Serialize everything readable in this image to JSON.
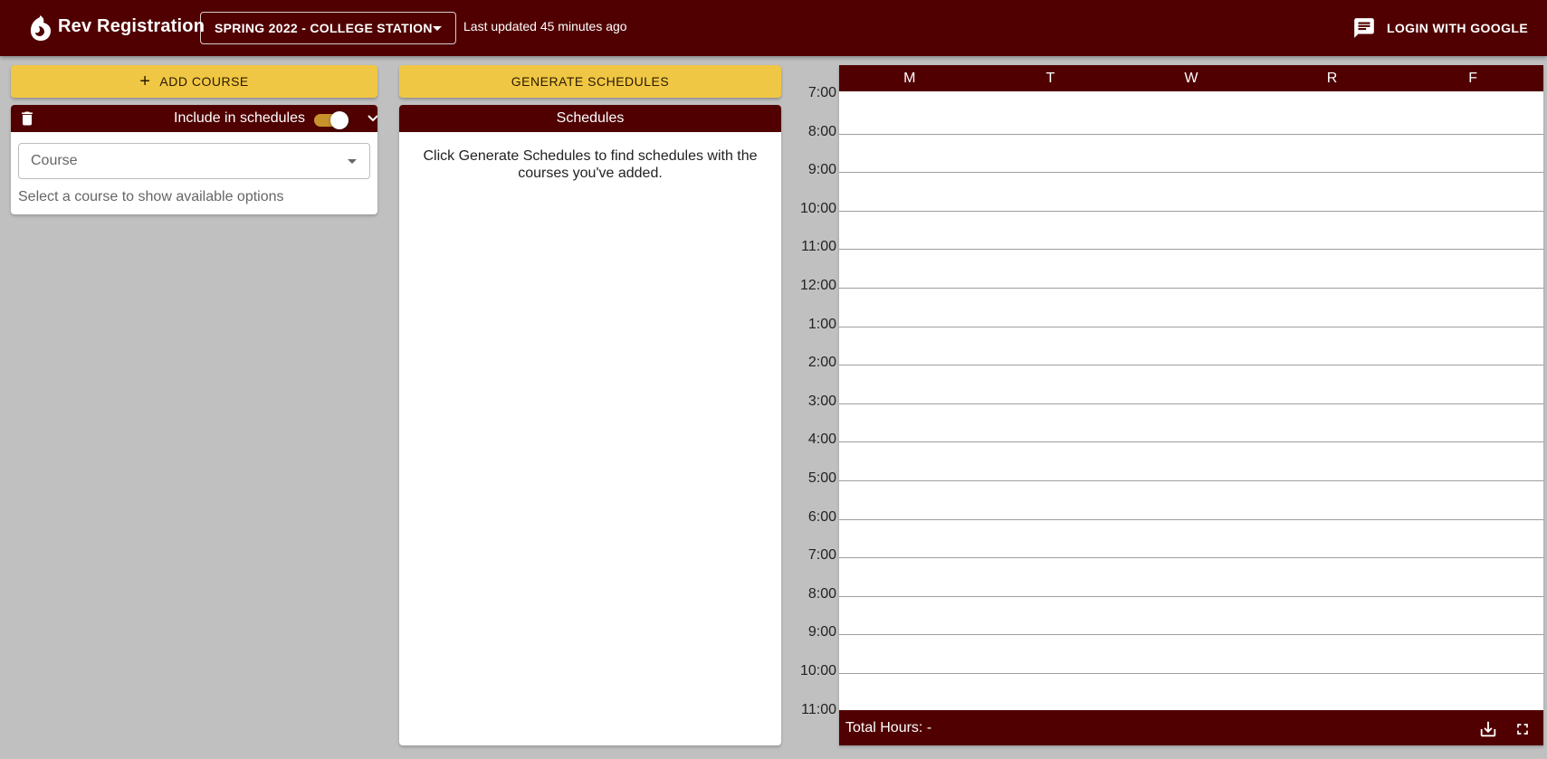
{
  "header": {
    "title": "Rev Registration",
    "term": "SPRING 2022 - COLLEGE STATION",
    "last_updated": "Last updated 45 minutes ago",
    "login_label": "LOGIN WITH GOOGLE"
  },
  "courses_panel": {
    "add_course_label": "ADD COURSE",
    "card": {
      "include_label": "Include in schedules",
      "include_toggle_on": true,
      "course_placeholder": "Course",
      "hint": "Select a course to show available options"
    }
  },
  "schedules_panel": {
    "generate_label": "GENERATE SCHEDULES",
    "title": "Schedules",
    "message": "Click Generate Schedules to find schedules with the courses you've added."
  },
  "calendar": {
    "days": [
      "M",
      "T",
      "W",
      "R",
      "F"
    ],
    "times": [
      "7:00",
      "8:00",
      "9:00",
      "10:00",
      "11:00",
      "12:00",
      "1:00",
      "2:00",
      "3:00",
      "4:00",
      "5:00",
      "6:00",
      "7:00",
      "8:00",
      "9:00",
      "10:00",
      "11:00"
    ],
    "total_hours": "Total Hours: -"
  },
  "colors": {
    "maroon": "#500000",
    "gold_button": "#f0c744",
    "toggle_track": "#c8932c",
    "background": "#c0c0c0"
  }
}
